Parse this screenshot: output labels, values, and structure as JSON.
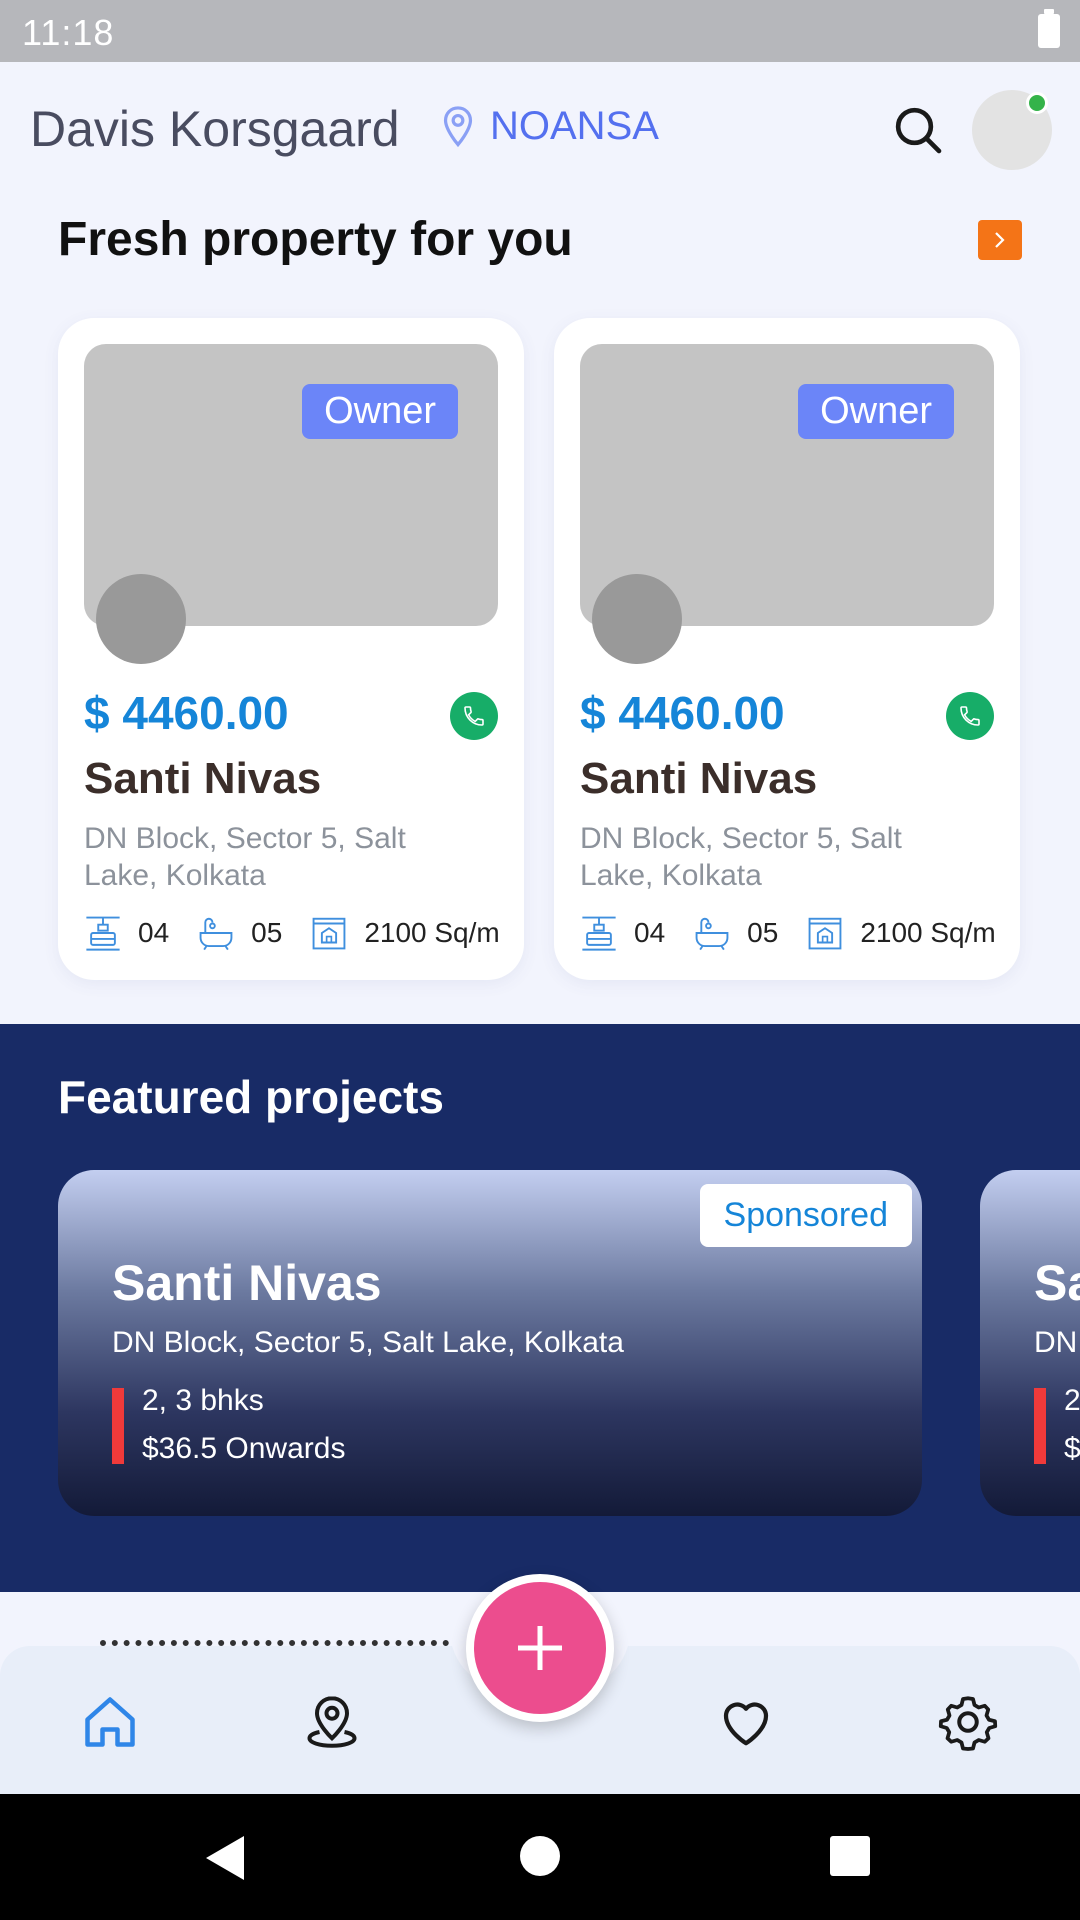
{
  "status_bar": {
    "time": "11:18"
  },
  "header": {
    "user_name": "Davis Korsgaard",
    "location": "NOANSA",
    "icons": {
      "location": "location-pin-icon",
      "search": "search-icon"
    }
  },
  "fresh": {
    "title": "Fresh property for you",
    "cards": [
      {
        "tag": "Owner",
        "price": "$ 4460.00",
        "name": "Santi Nivas",
        "address": "DN Block, Sector 5, Salt Lake, Kolkata",
        "beds": "04",
        "baths": "05",
        "area": "2100 Sq/m"
      },
      {
        "tag": "Owner",
        "price": "$ 4460.00",
        "name": "Santi Nivas",
        "address": "DN Block, Sector 5, Salt Lake, Kolkata",
        "beds": "04",
        "baths": "05",
        "area": "2100 Sq/m"
      }
    ]
  },
  "featured": {
    "title": "Featured projects",
    "projects": [
      {
        "badge": "Sponsored",
        "name": "Santi Nivas",
        "address": "DN Block, Sector 5, Salt Lake, Kolkata",
        "bhk": "2, 3 bhks",
        "price": "$36.5 Onwards"
      },
      {
        "name": "Sa",
        "address": "DN",
        "bhk": "2",
        "price": "$"
      }
    ]
  },
  "bottom_nav": {
    "items": [
      "home-icon",
      "map-pin-icon",
      "add-icon",
      "heart-icon",
      "settings-icon"
    ]
  },
  "colors": {
    "accent_blue": "#1585d8",
    "brand_indigo": "#182b66",
    "fab_pink": "#ec4d8e",
    "owner_tag": "#6b85f8",
    "call_green": "#17ad68",
    "see_all_orange": "#f47417"
  }
}
